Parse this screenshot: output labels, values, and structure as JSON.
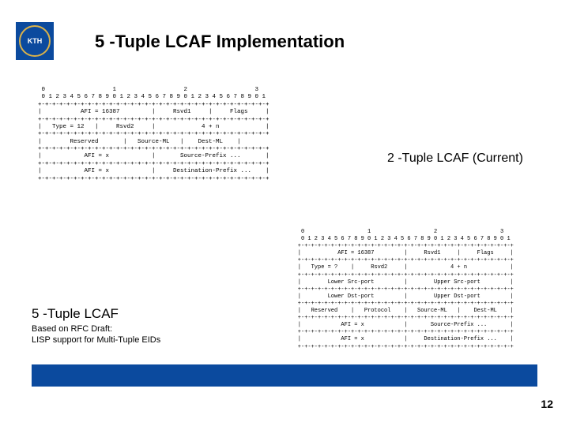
{
  "logo": {
    "text": "KTH"
  },
  "title": "5 -Tuple LCAF Implementation",
  "label_2tuple": "2 -Tuple LCAF (Current)",
  "label_5tuple": "5 -Tuple LCAF",
  "sublabel_line1": "Based on RFC Draft:",
  "sublabel_line2": "LISP support for Multi-Tuple EIDs",
  "page_number": "12",
  "diagram1": "     0                   1                   2                   3\n     0 1 2 3 4 5 6 7 8 9 0 1 2 3 4 5 6 7 8 9 0 1 2 3 4 5 6 7 8 9 0 1\n    +-+-+-+-+-+-+-+-+-+-+-+-+-+-+-+-+-+-+-+-+-+-+-+-+-+-+-+-+-+-+-+-+\n    |           AFI = 16387         |     Rsvd1     |     Flags     |\n    +-+-+-+-+-+-+-+-+-+-+-+-+-+-+-+-+-+-+-+-+-+-+-+-+-+-+-+-+-+-+-+-+\n    |   Type = 12   |     Rsvd2     |             4 + n             |\n    +-+-+-+-+-+-+-+-+-+-+-+-+-+-+-+-+-+-+-+-+-+-+-+-+-+-+-+-+-+-+-+-+\n    |        Reserved       |   Source-ML   |    Dest-ML    |\n    +-+-+-+-+-+-+-+-+-+-+-+-+-+-+-+-+-+-+-+-+-+-+-+-+-+-+-+-+-+-+-+-+\n    |            AFI = x            |       Source-Prefix ...       |\n    +-+-+-+-+-+-+-+-+-+-+-+-+-+-+-+-+-+-+-+-+-+-+-+-+-+-+-+-+-+-+-+-+\n    |            AFI = x            |     Destination-Prefix ...    |\n    +-+-+-+-+-+-+-+-+-+-+-+-+-+-+-+-+-+-+-+-+-+-+-+-+-+-+-+-+-+-+-+-+",
  "diagram2": "     0                   1                   2                   3\n     0 1 2 3 4 5 6 7 8 9 0 1 2 3 4 5 6 7 8 9 0 1 2 3 4 5 6 7 8 9 0 1\n    +-+-+-+-+-+-+-+-+-+-+-+-+-+-+-+-+-+-+-+-+-+-+-+-+-+-+-+-+-+-+-+-+\n    |           AFI = 16387         |     Rsvd1     |     Flags     |\n    +-+-+-+-+-+-+-+-+-+-+-+-+-+-+-+-+-+-+-+-+-+-+-+-+-+-+-+-+-+-+-+-+\n    |   Type = ?    |     Rsvd2     |             4 + n             |\n    +-+-+-+-+-+-+-+-+-+-+-+-+-+-+-+-+-+-+-+-+-+-+-+-+-+-+-+-+-+-+-+-+\n    |        Lower Src-port         |        Upper Src-port         |\n    +-+-+-+-+-+-+-+-+-+-+-+-+-+-+-+-+-+-+-+-+-+-+-+-+-+-+-+-+-+-+-+-+\n    |        Lower Dst-port         |        Upper Dst-port         |\n    +-+-+-+-+-+-+-+-+-+-+-+-+-+-+-+-+-+-+-+-+-+-+-+-+-+-+-+-+-+-+-+-+\n    |   Reserved    |   Protocol    |   Source-ML   |    Dest-ML    |\n    +-+-+-+-+-+-+-+-+-+-+-+-+-+-+-+-+-+-+-+-+-+-+-+-+-+-+-+-+-+-+-+-+\n    |            AFI = x            |       Source-Prefix ...       |\n    +-+-+-+-+-+-+-+-+-+-+-+-+-+-+-+-+-+-+-+-+-+-+-+-+-+-+-+-+-+-+-+-+\n    |            AFI = x            |     Destination-Prefix ...    |\n    +-+-+-+-+-+-+-+-+-+-+-+-+-+-+-+-+-+-+-+-+-+-+-+-+-+-+-+-+-+-+-+-+"
}
